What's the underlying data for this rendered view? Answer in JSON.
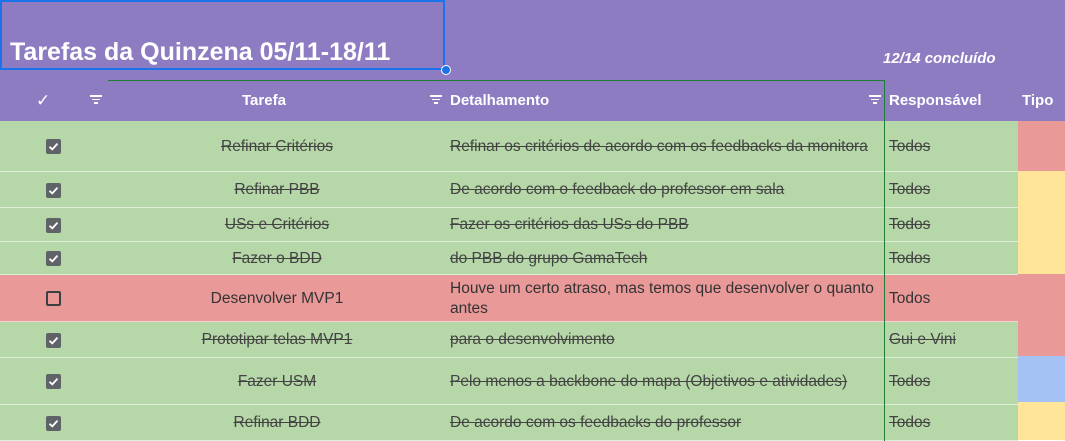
{
  "title": "Tarefas da Quinzena 05/11-18/11",
  "progress_text": "12/14 concluído",
  "headers": {
    "check": "✓",
    "tarefa": "Tarefa",
    "detalhamento": "Detalhamento",
    "responsavel": "Responsável",
    "tipo": "Tipo"
  },
  "colors": {
    "header_bg": "#8e7cc3",
    "done_row": "#b6d7a8",
    "pending_row": "#ea9999",
    "tipo_red": "#ea9999",
    "tipo_yellow": "#ffe599",
    "tipo_blue": "#a4c2f4"
  },
  "rows": [
    {
      "done": true,
      "tarefa": "Refinar Critérios",
      "detalhamento": "Refinar os critérios de acordo com os feedbacks da monitora",
      "responsavel": "Todos"
    },
    {
      "done": true,
      "tarefa": "Refinar PBB",
      "detalhamento": "De acordo com o feedback do professor em sala",
      "responsavel": "Todos"
    },
    {
      "done": true,
      "tarefa": "USs e Critérios",
      "detalhamento": "Fazer os critérios das USs do PBB",
      "responsavel": "Todos"
    },
    {
      "done": true,
      "tarefa": "Fazer o BDD",
      "detalhamento": "do PBB do grupo GamaTech",
      "responsavel": "Todos"
    },
    {
      "done": false,
      "tarefa": "Desenvolver MVP1",
      "detalhamento": "Houve um certo atraso, mas temos que desenvolver o quanto antes",
      "responsavel": "Todos"
    },
    {
      "done": true,
      "tarefa": "Prototipar telas MVP1",
      "detalhamento": "para o desenvolvimento",
      "responsavel": "Gui e Vini"
    },
    {
      "done": true,
      "tarefa": "Fazer USM",
      "detalhamento": "Pelo menos a backbone do mapa (Objetivos e atividades)",
      "responsavel": "Todos"
    },
    {
      "done": true,
      "tarefa": "Refinar BDD",
      "detalhamento": "De acordo com os feedbacks do professor",
      "responsavel": "Todos"
    }
  ],
  "tipo_colors": [
    "#ea9999",
    "#ffe599",
    "#ea9999",
    "#a4c2f4",
    "#ffe599"
  ]
}
